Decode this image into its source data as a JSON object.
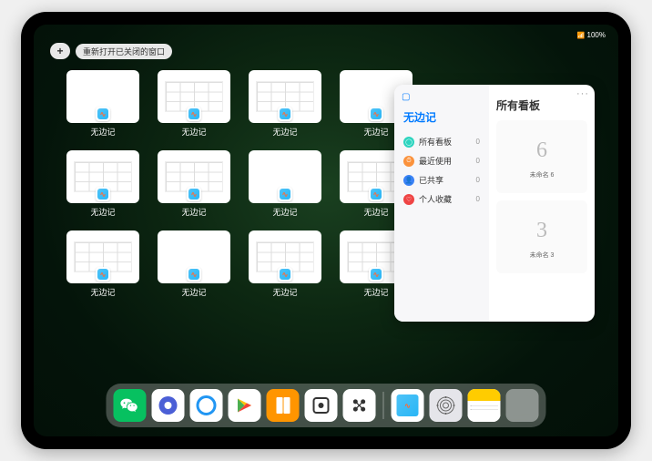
{
  "statusbar": {
    "time": "",
    "battery": "100%"
  },
  "topbar": {
    "plus": "+",
    "reopen_label": "重新打开已关闭的窗口"
  },
  "app_label": "无边记",
  "windows": [
    {
      "label": "无边记",
      "style": "blank"
    },
    {
      "label": "无边记",
      "style": "grid"
    },
    {
      "label": "无边记",
      "style": "grid"
    },
    {
      "label": "无边记",
      "style": "blank"
    },
    {
      "label": "无边记",
      "style": "grid"
    },
    {
      "label": "无边记",
      "style": "grid"
    },
    {
      "label": "无边记",
      "style": "blank"
    },
    {
      "label": "无边记",
      "style": "grid"
    },
    {
      "label": "无边记",
      "style": "grid"
    },
    {
      "label": "无边记",
      "style": "blank"
    },
    {
      "label": "无边记",
      "style": "grid"
    },
    {
      "label": "无边记",
      "style": "grid"
    }
  ],
  "large_window": {
    "sidebar_title": "无边记",
    "items": [
      {
        "label": "所有看板",
        "count": "0",
        "color": "teal",
        "glyph": "◯"
      },
      {
        "label": "最近使用",
        "count": "0",
        "color": "orange",
        "glyph": "⏱"
      },
      {
        "label": "已共享",
        "count": "0",
        "color": "blue",
        "glyph": "👤"
      },
      {
        "label": "个人收藏",
        "count": "0",
        "color": "red",
        "glyph": "♡"
      }
    ],
    "main_title": "所有看板",
    "boards": [
      {
        "name": "未命名 6",
        "sketch": "6"
      },
      {
        "name": "未命名 3",
        "sketch": "3"
      }
    ]
  },
  "dock": {
    "apps": [
      {
        "name": "wechat",
        "bg": "#07c160",
        "glyph": "●●"
      },
      {
        "name": "quark",
        "bg": "#ffffff",
        "glyph": "◉"
      },
      {
        "name": "qqbrowser",
        "bg": "#ffffff",
        "glyph": "◯"
      },
      {
        "name": "play",
        "bg": "#ffffff",
        "glyph": "▶"
      },
      {
        "name": "books",
        "bg": "#ff9500",
        "glyph": "▮▮"
      },
      {
        "name": "camera-obscura",
        "bg": "#ffffff",
        "glyph": "⊡"
      },
      {
        "name": "dots",
        "bg": "#ffffff",
        "glyph": "●●"
      }
    ],
    "recent": [
      {
        "name": "freeform",
        "bg": "#ffffff"
      },
      {
        "name": "settings",
        "bg": "#e5e5ea",
        "glyph": "⚙"
      },
      {
        "name": "notes",
        "bg": "#ffffff",
        "glyph": "▬"
      }
    ]
  }
}
